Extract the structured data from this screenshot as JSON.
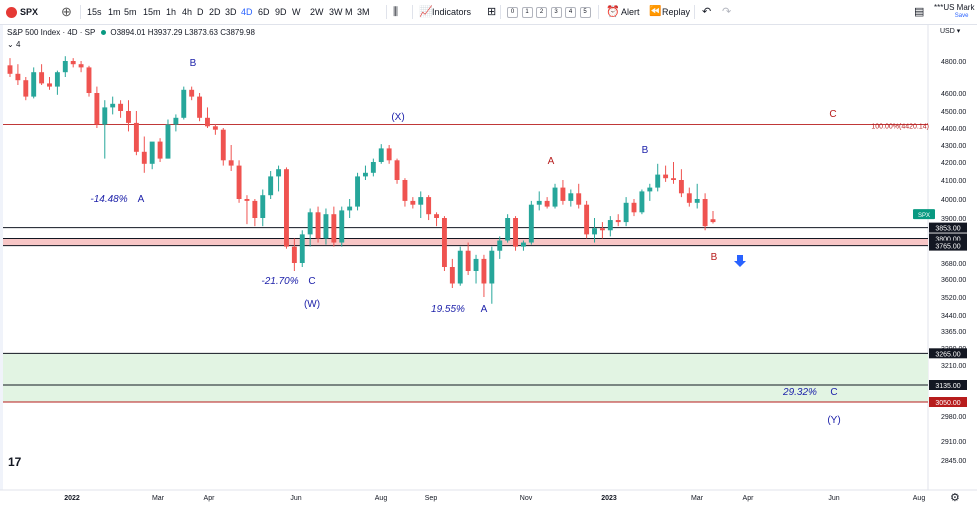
{
  "toolbar": {
    "symbol": "SPX",
    "timeframes": [
      "15s",
      "1m",
      "5m",
      "15m",
      "1h",
      "4h",
      "D",
      "2D",
      "3D",
      "4D",
      "6D",
      "9D",
      "W",
      "2W",
      "3W",
      "M",
      "3M"
    ],
    "active_timeframe": "4D",
    "indicators_label": "Indicators",
    "layout_numbers": [
      "0",
      "1",
      "2",
      "3",
      "4",
      "5"
    ],
    "alert_label": "Alert",
    "replay_label": "Replay",
    "market_label": "***US Mark",
    "save_label": "Save"
  },
  "legend": {
    "title": "S&P 500 Index · 4D · SP",
    "ohlc": "O3894.01 H3937.29 L3873.63 C3879.98",
    "indicator_count": "4",
    "status_color": "#089981"
  },
  "currency": "USD",
  "settings_icon": "gear-icon",
  "logo": "tradingview-logo",
  "colors": {
    "up": "#26a69a",
    "down": "#ef5350",
    "accent": "#2962ff",
    "wave_blue": "#1e22aa",
    "wave_red": "#b71c1c"
  },
  "chart_data": {
    "type": "candlestick",
    "symbol": "SPX",
    "interval": "4D",
    "x_ticks": [
      "2022",
      "Mar",
      "Apr",
      "Jun",
      "Aug",
      "Sep",
      "Nov",
      "2023",
      "Mar",
      "Apr",
      "Jun",
      "Aug"
    ],
    "y_ticks": [
      4800,
      4600,
      4500,
      4400,
      4300,
      4200,
      4100,
      4000,
      3900,
      3680,
      3600,
      3520,
      3440,
      3365,
      3290,
      3210,
      3135,
      2980,
      2910,
      2845
    ],
    "ylim": [
      2800,
      4900
    ],
    "candles": [
      {
        "o": 4773,
        "h": 4818,
        "l": 4700,
        "c": 4720
      },
      {
        "o": 4720,
        "h": 4780,
        "l": 4650,
        "c": 4680
      },
      {
        "o": 4680,
        "h": 4700,
        "l": 4560,
        "c": 4580
      },
      {
        "o": 4580,
        "h": 4760,
        "l": 4570,
        "c": 4730
      },
      {
        "o": 4730,
        "h": 4780,
        "l": 4650,
        "c": 4660
      },
      {
        "o": 4660,
        "h": 4700,
        "l": 4620,
        "c": 4640
      },
      {
        "o": 4640,
        "h": 4740,
        "l": 4590,
        "c": 4730
      },
      {
        "o": 4730,
        "h": 4830,
        "l": 4700,
        "c": 4800
      },
      {
        "o": 4800,
        "h": 4818,
        "l": 4760,
        "c": 4780
      },
      {
        "o": 4780,
        "h": 4800,
        "l": 4730,
        "c": 4760
      },
      {
        "o": 4760,
        "h": 4770,
        "l": 4580,
        "c": 4600
      },
      {
        "o": 4600,
        "h": 4640,
        "l": 4400,
        "c": 4420
      },
      {
        "o": 4420,
        "h": 4560,
        "l": 4220,
        "c": 4520
      },
      {
        "o": 4520,
        "h": 4580,
        "l": 4480,
        "c": 4540
      },
      {
        "o": 4540,
        "h": 4560,
        "l": 4460,
        "c": 4500
      },
      {
        "o": 4500,
        "h": 4560,
        "l": 4380,
        "c": 4430
      },
      {
        "o": 4430,
        "h": 4500,
        "l": 4240,
        "c": 4260
      },
      {
        "o": 4260,
        "h": 4350,
        "l": 4140,
        "c": 4190
      },
      {
        "o": 4190,
        "h": 4300,
        "l": 4160,
        "c": 4320
      },
      {
        "o": 4320,
        "h": 4340,
        "l": 4200,
        "c": 4220
      },
      {
        "o": 4220,
        "h": 4450,
        "l": 4220,
        "c": 4420
      },
      {
        "o": 4420,
        "h": 4480,
        "l": 4380,
        "c": 4460
      },
      {
        "o": 4460,
        "h": 4640,
        "l": 4450,
        "c": 4620
      },
      {
        "o": 4620,
        "h": 4640,
        "l": 4560,
        "c": 4580
      },
      {
        "o": 4580,
        "h": 4600,
        "l": 4440,
        "c": 4460
      },
      {
        "o": 4460,
        "h": 4520,
        "l": 4400,
        "c": 4410
      },
      {
        "o": 4410,
        "h": 4420,
        "l": 4360,
        "c": 4390
      },
      {
        "o": 4390,
        "h": 4400,
        "l": 4180,
        "c": 4210
      },
      {
        "o": 4210,
        "h": 4300,
        "l": 4150,
        "c": 4180
      },
      {
        "o": 4180,
        "h": 4210,
        "l": 3980,
        "c": 4000
      },
      {
        "o": 4000,
        "h": 4020,
        "l": 3870,
        "c": 3990
      },
      {
        "o": 3990,
        "h": 4000,
        "l": 3860,
        "c": 3900
      },
      {
        "o": 3900,
        "h": 4050,
        "l": 3860,
        "c": 4020
      },
      {
        "o": 4020,
        "h": 4150,
        "l": 4000,
        "c": 4120
      },
      {
        "o": 4120,
        "h": 4180,
        "l": 4040,
        "c": 4160
      },
      {
        "o": 4160,
        "h": 4170,
        "l": 3750,
        "c": 3760
      },
      {
        "o": 3760,
        "h": 3800,
        "l": 3640,
        "c": 3680
      },
      {
        "o": 3680,
        "h": 3840,
        "l": 3660,
        "c": 3820
      },
      {
        "o": 3820,
        "h": 3950,
        "l": 3760,
        "c": 3930
      },
      {
        "o": 3930,
        "h": 3960,
        "l": 3780,
        "c": 3800
      },
      {
        "o": 3800,
        "h": 3950,
        "l": 3770,
        "c": 3920
      },
      {
        "o": 3920,
        "h": 3960,
        "l": 3760,
        "c": 3780
      },
      {
        "o": 3780,
        "h": 3960,
        "l": 3760,
        "c": 3940
      },
      {
        "o": 3940,
        "h": 4000,
        "l": 3900,
        "c": 3960
      },
      {
        "o": 3960,
        "h": 4140,
        "l": 3940,
        "c": 4120
      },
      {
        "o": 4120,
        "h": 4180,
        "l": 4100,
        "c": 4140
      },
      {
        "o": 4140,
        "h": 4220,
        "l": 4120,
        "c": 4200
      },
      {
        "o": 4200,
        "h": 4305,
        "l": 4190,
        "c": 4280
      },
      {
        "o": 4280,
        "h": 4300,
        "l": 4190,
        "c": 4210
      },
      {
        "o": 4210,
        "h": 4220,
        "l": 4080,
        "c": 4100
      },
      {
        "o": 4100,
        "h": 4110,
        "l": 3960,
        "c": 3990
      },
      {
        "o": 3990,
        "h": 4010,
        "l": 3950,
        "c": 3970
      },
      {
        "o": 3970,
        "h": 4040,
        "l": 3900,
        "c": 4010
      },
      {
        "o": 4010,
        "h": 4020,
        "l": 3890,
        "c": 3920
      },
      {
        "o": 3920,
        "h": 3930,
        "l": 3860,
        "c": 3900
      },
      {
        "o": 3900,
        "h": 3910,
        "l": 3640,
        "c": 3660
      },
      {
        "o": 3660,
        "h": 3700,
        "l": 3560,
        "c": 3580
      },
      {
        "o": 3580,
        "h": 3760,
        "l": 3570,
        "c": 3740
      },
      {
        "o": 3740,
        "h": 3780,
        "l": 3620,
        "c": 3640
      },
      {
        "o": 3640,
        "h": 3720,
        "l": 3580,
        "c": 3700
      },
      {
        "o": 3700,
        "h": 3720,
        "l": 3520,
        "c": 3580
      },
      {
        "o": 3580,
        "h": 3760,
        "l": 3490,
        "c": 3740
      },
      {
        "o": 3740,
        "h": 3810,
        "l": 3700,
        "c": 3790
      },
      {
        "o": 3790,
        "h": 3920,
        "l": 3780,
        "c": 3900
      },
      {
        "o": 3900,
        "h": 3910,
        "l": 3740,
        "c": 3760
      },
      {
        "o": 3760,
        "h": 3790,
        "l": 3740,
        "c": 3780
      },
      {
        "o": 3780,
        "h": 3990,
        "l": 3770,
        "c": 3970
      },
      {
        "o": 3970,
        "h": 4040,
        "l": 3940,
        "c": 3990
      },
      {
        "o": 3990,
        "h": 4010,
        "l": 3950,
        "c": 3960
      },
      {
        "o": 3960,
        "h": 4080,
        "l": 3950,
        "c": 4060
      },
      {
        "o": 4060,
        "h": 4100,
        "l": 3970,
        "c": 3990
      },
      {
        "o": 3990,
        "h": 4050,
        "l": 3960,
        "c": 4030
      },
      {
        "o": 4030,
        "h": 4080,
        "l": 3950,
        "c": 3970
      },
      {
        "o": 3970,
        "h": 3990,
        "l": 3800,
        "c": 3820
      },
      {
        "o": 3820,
        "h": 3900,
        "l": 3780,
        "c": 3850
      },
      {
        "o": 3850,
        "h": 3880,
        "l": 3800,
        "c": 3840
      },
      {
        "o": 3840,
        "h": 3910,
        "l": 3810,
        "c": 3890
      },
      {
        "o": 3890,
        "h": 3920,
        "l": 3860,
        "c": 3880
      },
      {
        "o": 3880,
        "h": 4010,
        "l": 3860,
        "c": 3980
      },
      {
        "o": 3980,
        "h": 4000,
        "l": 3910,
        "c": 3930
      },
      {
        "o": 3930,
        "h": 4050,
        "l": 3920,
        "c": 4040
      },
      {
        "o": 4040,
        "h": 4080,
        "l": 3990,
        "c": 4060
      },
      {
        "o": 4060,
        "h": 4190,
        "l": 4040,
        "c": 4130
      },
      {
        "o": 4130,
        "h": 4180,
        "l": 4090,
        "c": 4110
      },
      {
        "o": 4110,
        "h": 4200,
        "l": 4080,
        "c": 4100
      },
      {
        "o": 4100,
        "h": 4160,
        "l": 4010,
        "c": 4030
      },
      {
        "o": 4030,
        "h": 4060,
        "l": 3960,
        "c": 3980
      },
      {
        "o": 3980,
        "h": 4080,
        "l": 3950,
        "c": 4000
      },
      {
        "o": 4000,
        "h": 4030,
        "l": 3840,
        "c": 3860
      },
      {
        "o": 3894,
        "h": 3937,
        "l": 3873,
        "c": 3880
      }
    ],
    "horizontal_levels": [
      {
        "price": 4420.14,
        "label": "100.00%(4420.14)",
        "color": "#b71c1c"
      },
      {
        "price": 3853,
        "label": "3853.00",
        "color": "#131722"
      },
      {
        "price": 3800,
        "label": "3800.00",
        "color": "#131722"
      },
      {
        "price": 3765,
        "label": "3765.00",
        "color": "#131722"
      },
      {
        "price": 3265,
        "label": "3265.00",
        "color": "#131722"
      },
      {
        "price": 3135,
        "label": "3135.00",
        "color": "#131722"
      },
      {
        "price": 3050,
        "label": "3050.00",
        "color": "#b71c1c"
      }
    ],
    "zones": [
      {
        "from": 3765,
        "to": 3800,
        "color": "#f8c6c6"
      },
      {
        "from": 3050,
        "to": 3265,
        "color": "#e2f4e3"
      }
    ],
    "price_tag": {
      "label": "SPX",
      "price": 3879.98
    },
    "wave_labels": [
      {
        "text": "B",
        "color": "#1e22aa",
        "italic": false
      },
      {
        "text": "A",
        "color": "#1e22aa",
        "italic": false
      },
      {
        "text": "-14.48%",
        "color": "#1e22aa",
        "italic": true
      },
      {
        "text": "(X)",
        "color": "#1e22aa",
        "italic": false
      },
      {
        "text": "C",
        "color": "#1e22aa",
        "italic": false
      },
      {
        "text": "-21.70%",
        "color": "#1e22aa",
        "italic": true
      },
      {
        "text": "(W)",
        "color": "#1e22aa",
        "italic": false
      },
      {
        "text": "19.55%",
        "color": "#1e22aa",
        "italic": true
      },
      {
        "text": "A",
        "color": "#1e22aa",
        "italic": false
      },
      {
        "text": "A",
        "color": "#b71c1c",
        "italic": false
      },
      {
        "text": "B",
        "color": "#1e22aa",
        "italic": false
      },
      {
        "text": "B",
        "color": "#b71c1c",
        "italic": false
      },
      {
        "text": "C",
        "color": "#b71c1c",
        "italic": false
      },
      {
        "text": "29.32%",
        "color": "#1e22aa",
        "italic": true
      },
      {
        "text": "C",
        "color": "#1e22aa",
        "italic": false
      },
      {
        "text": "(Y)",
        "color": "#1e22aa",
        "italic": false
      }
    ]
  }
}
